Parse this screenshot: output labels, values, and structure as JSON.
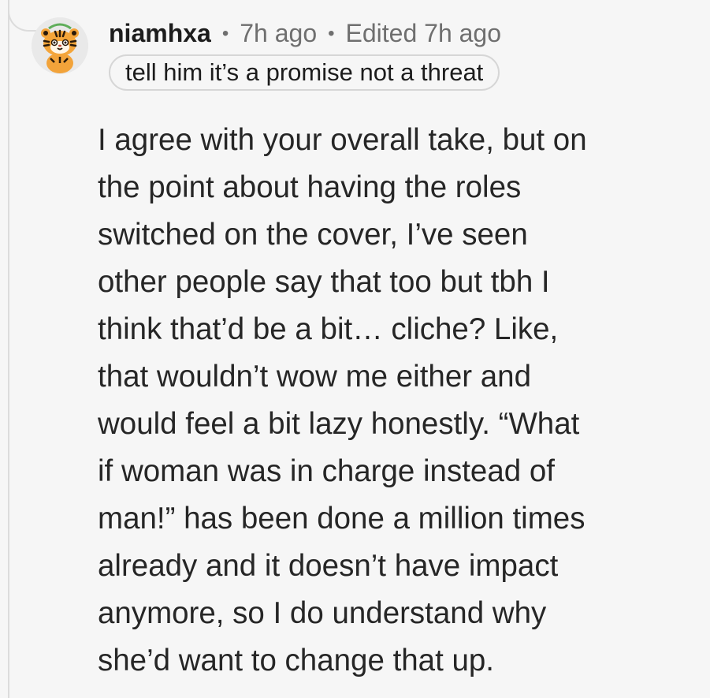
{
  "comment": {
    "username": "niamhxa",
    "time": "7h ago",
    "edited": "Edited 7h ago",
    "flair": "tell him it’s a promise not a threat",
    "avatar_icon": "tiger-snoo-avatar-icon",
    "body_lines": [
      "I agree with your overall take, but on",
      "the point about having the roles",
      "switched on the cover, I’ve seen",
      "other people say that too but tbh I",
      "think that’d be a bit… cliche? Like,",
      "that wouldn’t wow me either and",
      "would feel a bit lazy honestly. “What",
      "if woman was in charge instead of",
      "man!” has been done a million times",
      "already and it doesn’t have impact",
      "anymore, so I do understand why",
      "she’d want to change that up."
    ]
  },
  "colors": {
    "background": "#f6f6f6",
    "text": "#1c1c1c",
    "meta": "#6f6f6f",
    "thread_line": "#dcdcdc"
  }
}
